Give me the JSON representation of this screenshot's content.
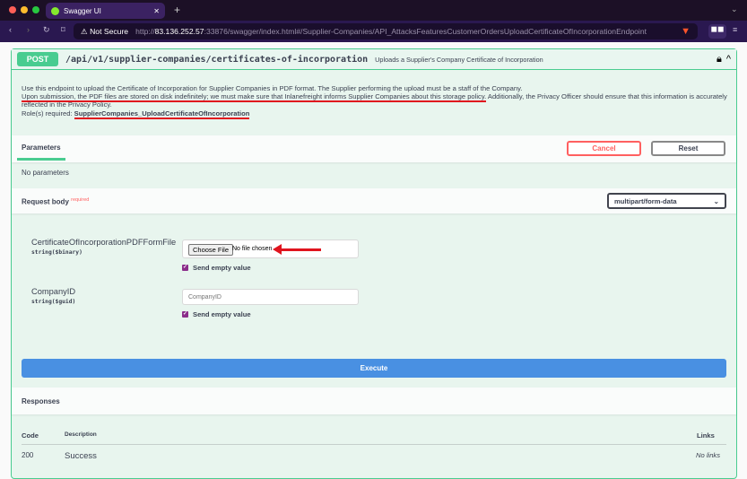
{
  "browser": {
    "tab_title": "Swagger UI",
    "security": "Not Secure",
    "url_prefix": "http://",
    "url_host": "83.136.252.57",
    "url_rest": ":33876/swagger/index.html#/Supplier-Companies/API_AttacksFeaturesCustomerOrdersUploadCertificateOfIncorporationEndpoint"
  },
  "operation": {
    "method": "POST",
    "path": "/api/v1/supplier-companies/certificates-of-incorporation",
    "summary": "Uploads a Supplier's Company Certificate of Incorporation",
    "desc_line1": "Use this endpoint to upload the Certificate of Incorporation for Supplier Companies in PDF format. The Supplier performing the upload must be a staff of the Company.",
    "desc_line2_underlined": "Upon submission, the PDF files are stored on disk indefinitely; we must make sure that Inlanefreight informs Supplier Companies about this storage policy.",
    "desc_line2_rest": " Additionally, the Privacy Officer should ensure that this information is accurately reflected in the Privacy Policy.",
    "roles_label": "Role(s) required: ",
    "roles_value": "SupplierCompanies_UploadCertificateOfIncorporation"
  },
  "parameters": {
    "tab": "Parameters",
    "cancel": "Cancel",
    "reset": "Reset",
    "empty": "No parameters"
  },
  "request_body": {
    "title": "Request body",
    "required": "required",
    "content_type": "multipart/form-data",
    "fields": [
      {
        "name": "CertificateOfIncorporationPDFFormFile",
        "type": "string($binary)",
        "button": "Choose File",
        "value": "No file chosen",
        "send_empty": "Send empty value"
      },
      {
        "name": "CompanyID",
        "type": "string($guid)",
        "placeholder": "CompanyID",
        "send_empty": "Send empty value"
      }
    ]
  },
  "execute": "Execute",
  "responses": {
    "title": "Responses",
    "headers": {
      "code": "Code",
      "description": "Description",
      "links": "Links"
    },
    "rows": [
      {
        "code": "200",
        "description": "Success",
        "links": "No links"
      }
    ]
  },
  "colors": {
    "post": "#49cc90",
    "execute": "#4990e2",
    "cancel": "#ff6060",
    "annotation": "#e0141e"
  }
}
